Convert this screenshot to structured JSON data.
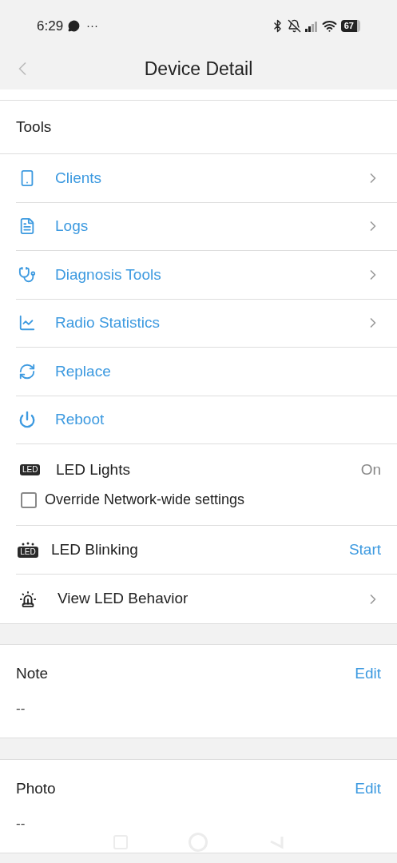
{
  "status_bar": {
    "time": "6:29",
    "more": "···",
    "battery": "67"
  },
  "header": {
    "title": "Device Detail"
  },
  "tools": {
    "title": "Tools",
    "items": [
      {
        "kind": "link",
        "label": "Clients"
      },
      {
        "kind": "link",
        "label": "Logs"
      },
      {
        "kind": "link",
        "label": "Diagnosis Tools"
      },
      {
        "kind": "link",
        "label": "Radio Statistics"
      },
      {
        "kind": "action",
        "label": "Replace"
      },
      {
        "kind": "action",
        "label": "Reboot"
      },
      {
        "kind": "setting",
        "icon_text": "LED",
        "label": "LED Lights",
        "value": "On",
        "option": {
          "label": "Override Network-wide settings",
          "checked": false
        }
      },
      {
        "kind": "button",
        "icon_text": "LED",
        "label": "LED Blinking",
        "action": "Start"
      },
      {
        "kind": "plain_link",
        "label": "View LED Behavior"
      }
    ]
  },
  "note": {
    "title": "Note",
    "action": "Edit",
    "value": "--"
  },
  "photo": {
    "title": "Photo",
    "action": "Edit",
    "value": "--"
  }
}
